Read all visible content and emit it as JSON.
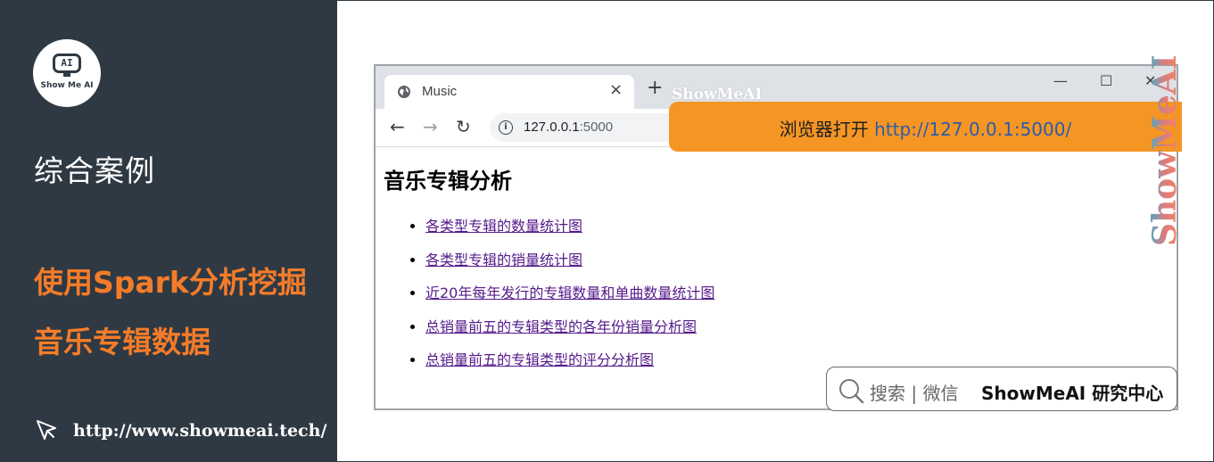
{
  "sidebar": {
    "logo_face": "AI",
    "logo_text": "Show Me AI",
    "section_title": "综合案例",
    "title_line1": "使用Spark分析挖掘",
    "title_line2": "音乐专辑数据",
    "footer_url": "http://www.showmeai.tech/"
  },
  "browser": {
    "tab_title": "Music",
    "tab_close": "×",
    "new_tab": "+",
    "window_min": "—",
    "window_max": "☐",
    "window_close": "✕",
    "address_host": "127.0.0.1",
    "address_port": ":5000",
    "nav_back": "←",
    "nav_forward": "→",
    "nav_reload": "↻"
  },
  "page": {
    "heading": "音乐专辑分析",
    "links": [
      "各类型专辑的数量统计图",
      "各类型专辑的销量统计图",
      "近20年每年发行的专辑数量和单曲数量统计图",
      "总销量前五的专辑类型的各年份销量分析图",
      "总销量前五的专辑类型的评分分析图"
    ]
  },
  "banner": {
    "text": "浏览器打开",
    "link": "http://127.0.0.1:5000/"
  },
  "watermark": {
    "inline": "ShowMeAI",
    "vertical": "ShowMeAI"
  },
  "search_box": {
    "placeholder": "搜索 | 微信",
    "brand": "ShowMeAI 研究中心"
  },
  "colors": {
    "sidebar_bg": "#2f3943",
    "accent_orange": "#f47c29",
    "banner_bg": "#f59524",
    "link_visited": "#551a8b"
  }
}
